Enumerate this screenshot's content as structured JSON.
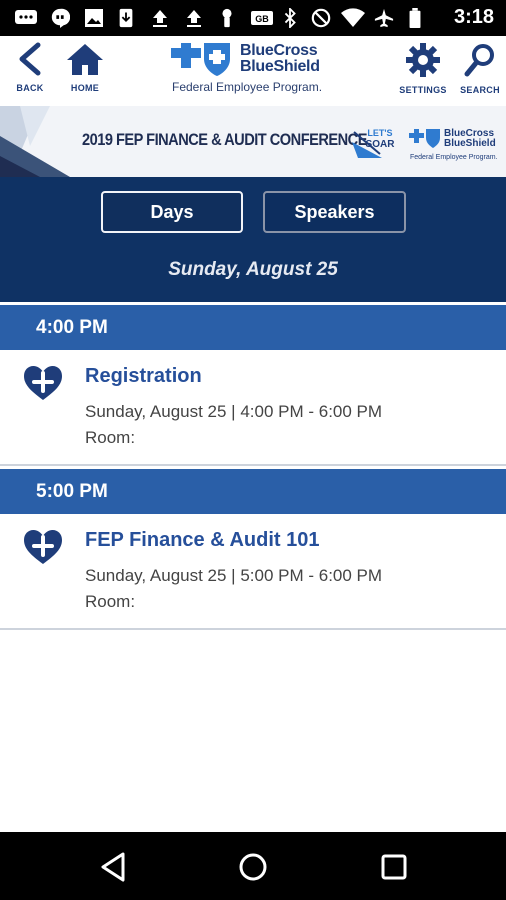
{
  "status_bar": {
    "time": "3:18",
    "icons": [
      "messages-icon",
      "hangouts-icon",
      "gallery-icon",
      "download-icon",
      "upload-icon",
      "upload-icon",
      "key-icon",
      "keyboard-icon",
      "bluetooth-icon",
      "do-not-disturb-icon",
      "wifi-icon",
      "airplane-icon",
      "battery-icon"
    ]
  },
  "header": {
    "back_label": "BACK",
    "home_label": "HOME",
    "settings_label": "SETTINGS",
    "search_label": "SEARCH",
    "brand_line1": "BlueCross",
    "brand_line2": "BlueShield",
    "brand_sub": "Federal Employee Program.",
    "brand_color": "#1f3d7a"
  },
  "banner": {
    "title": "2019 FEP FINANCE & AUDIT CONFERENCE",
    "soar_text_1": "LET'S",
    "soar_text_2": "SOAR",
    "logo_line1": "BlueCross",
    "logo_line2": "BlueShield",
    "logo_sub": "Federal Employee Program."
  },
  "nav": {
    "days_label": "Days",
    "speakers_label": "Speakers",
    "selected_day": "Sunday, August 25",
    "background_color": "#0f3264"
  },
  "schedule": [
    {
      "time": "4:00 PM",
      "sessions": [
        {
          "title": "Registration",
          "when": "Sunday, August 25 | 4:00 PM - 6:00 PM",
          "room": "Room:"
        }
      ]
    },
    {
      "time": "5:00 PM",
      "sessions": [
        {
          "title": "FEP Finance & Audit 101",
          "when": "Sunday, August 25 | 5:00 PM - 6:00 PM",
          "room": "Room:"
        }
      ]
    }
  ],
  "colors": {
    "time_header": "#2a5fa8",
    "session_title": "#264f9a",
    "heart_icon": "#1f3d7a"
  },
  "system_nav": {
    "icons": [
      "back-triangle-icon",
      "home-circle-icon",
      "recents-square-icon"
    ]
  }
}
